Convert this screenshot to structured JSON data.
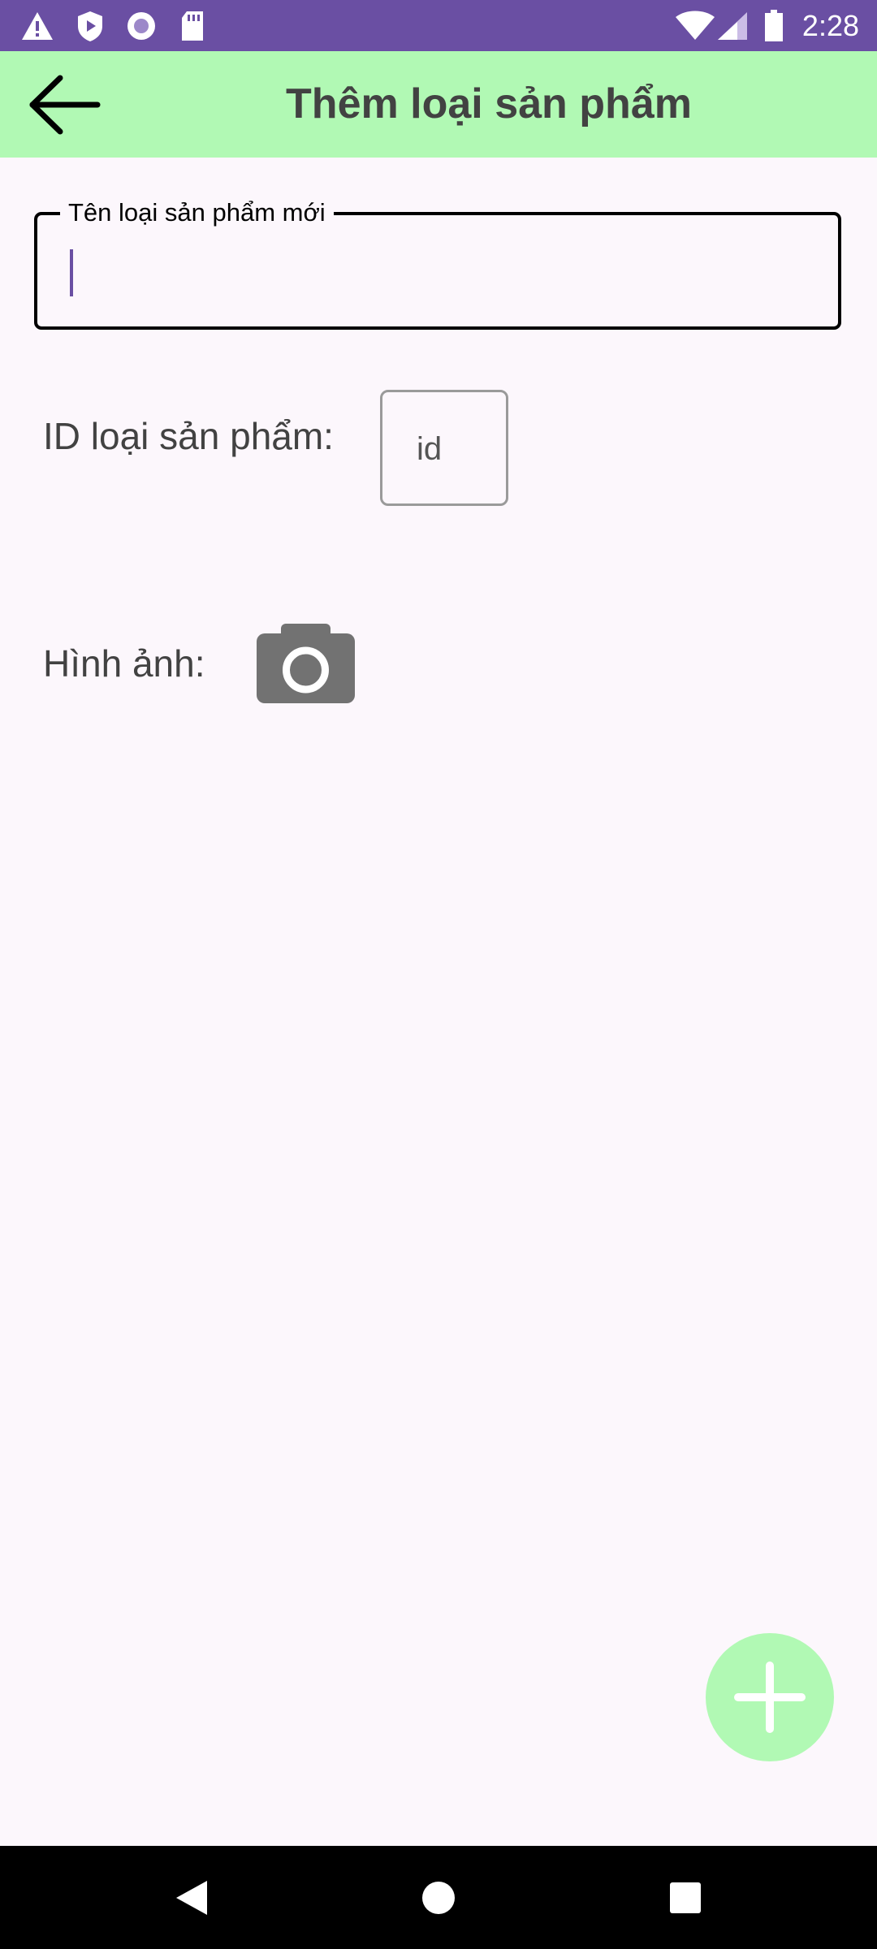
{
  "status_bar": {
    "time": "2:28",
    "left_icons": [
      "warning-icon",
      "shield-play-icon",
      "record-circle-icon",
      "sd-card-icon"
    ],
    "right_icons": [
      "wifi-icon",
      "cell-signal-icon",
      "battery-icon"
    ],
    "background": "#6A4FA3"
  },
  "app_bar": {
    "title": "Thêm loại sản phẩm",
    "background": "#B1F9B4",
    "back_icon": "arrow-back-icon"
  },
  "form": {
    "name_field": {
      "label": "Tên loại sản phẩm mới",
      "value": "",
      "cursor_color": "#6A4FA3"
    },
    "id_label": "ID loại sản phẩm:",
    "id_field": {
      "value": "id"
    },
    "image_label": "Hình ảnh:",
    "camera_icon": "camera-icon"
  },
  "fab": {
    "icon": "plus-icon",
    "background": "#B1F9B4"
  },
  "nav_bar": {
    "icons": [
      "back-triangle-icon",
      "home-circle-icon",
      "recents-square-icon"
    ]
  }
}
